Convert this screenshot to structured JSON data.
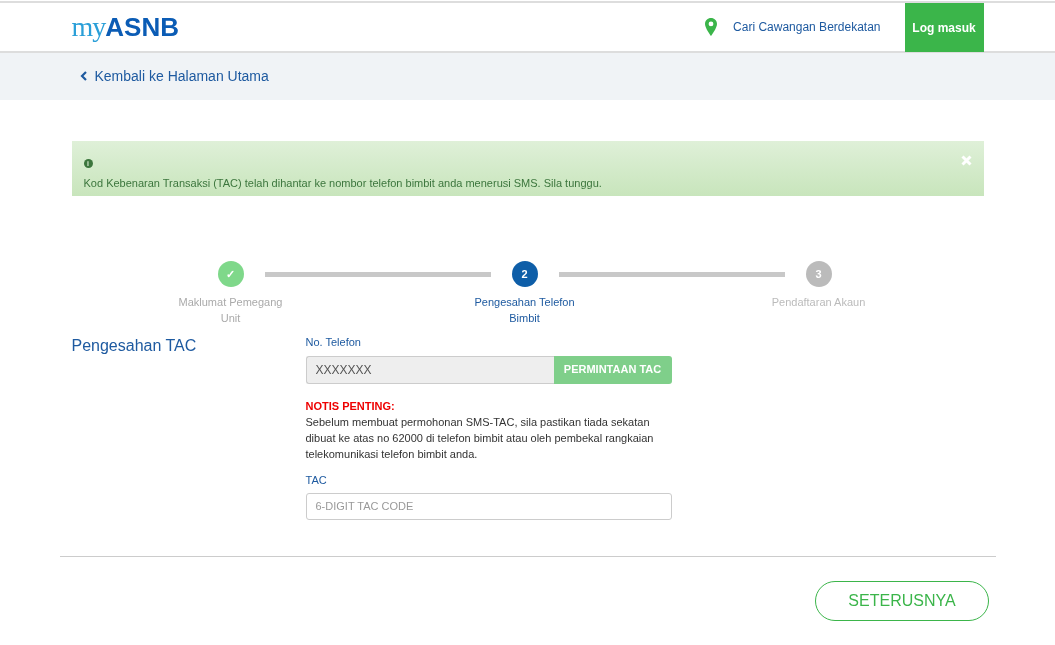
{
  "header": {
    "logo": {
      "light": "my",
      "bold": "ASNB"
    },
    "branch_link": "Cari Cawangan Berdekatan",
    "login_button": "Log masuk"
  },
  "back_link": "Kembali ke Halaman Utama",
  "alert": {
    "icon": "i",
    "message": "Kod Kebenaran Transaksi (TAC) telah dihantar ke nombor telefon bimbit anda menerusi SMS. Sila tunggu."
  },
  "steps": [
    {
      "label": "Maklumat Pemegang Unit",
      "marker": "✓",
      "kind": "done"
    },
    {
      "label": "Pengesahan Telefon Bimbit",
      "marker": "2",
      "kind": "active"
    },
    {
      "label": "Pendaftaran Akaun",
      "marker": "3",
      "kind": "pending"
    }
  ],
  "section_title": "Pengesahan TAC",
  "phone": {
    "label": "No. Telefon",
    "value": "XXXXXXX",
    "button": "PERMINTAAN TAC"
  },
  "notice": {
    "title": "NOTIS PENTING:",
    "text": "Sebelum membuat permohonan SMS-TAC, sila pastikan tiada sekatan dibuat ke atas no 62000 di telefon bimbit atau oleh pembekal rangkaian telekomunikasi telefon bimbit anda."
  },
  "tac": {
    "label": "TAC",
    "placeholder": "6-DIGIT TAC CODE"
  },
  "next_button": "SETERUSNYA"
}
